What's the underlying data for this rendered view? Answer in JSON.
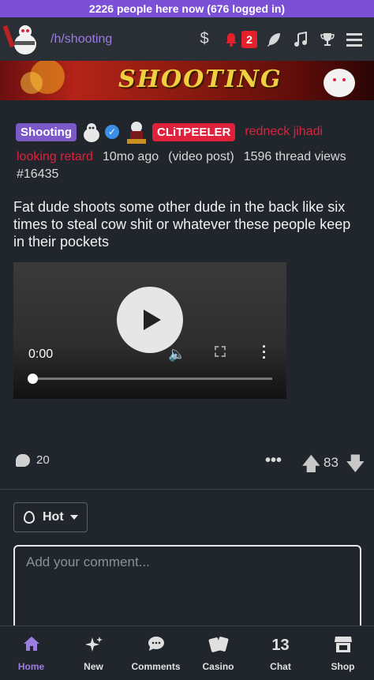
{
  "top_banner": {
    "text": "2226 people here now (676 logged in)"
  },
  "navbar": {
    "hole": "/h/shooting",
    "icons": [
      "dollar-icon",
      "bell-icon",
      "feather-icon",
      "music-icon",
      "trophy-icon",
      "menu-icon"
    ],
    "dollar": "$",
    "notification_count": "2"
  },
  "banner": {
    "text": "SHOOTING"
  },
  "post": {
    "hole_tag": "Shooting",
    "author": "CLiTPEELER",
    "flair_part1": "redneck jihadi",
    "flair_part2": "looking retard",
    "age": "10mo ago",
    "kind": "(video post)",
    "views": "1596 thread views",
    "id": "#16435",
    "title": "Fat dude shoots some other dude in the back like six times to steal cow shit or whatever these people keep in their pockets"
  },
  "video": {
    "time": "0:00",
    "progress": 0
  },
  "actions": {
    "comment_count": "20",
    "score": "83"
  },
  "sort": {
    "label": "Hot"
  },
  "comment_box": {
    "placeholder": "Add your comment..."
  },
  "bottom_nav": {
    "items": [
      {
        "label": "Home",
        "icon": "home-icon"
      },
      {
        "label": "New",
        "icon": "sparkle-icon"
      },
      {
        "label": "Comments",
        "icon": "chat-icon"
      },
      {
        "label": "Casino",
        "icon": "cards-icon"
      },
      {
        "label": "Chat",
        "count": "13"
      },
      {
        "label": "Shop",
        "icon": "store-icon"
      }
    ]
  },
  "colors": {
    "accent": "#7b4fd6",
    "author": "#e0213c",
    "background": "#21262d"
  }
}
